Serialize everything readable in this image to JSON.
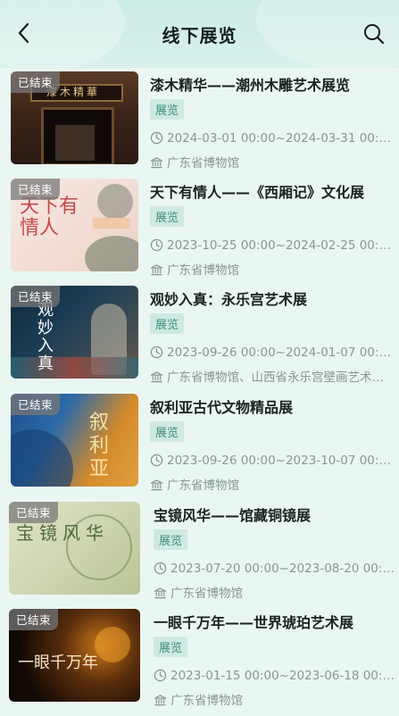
{
  "header": {
    "title": "线下展览",
    "back_icon": "chevron-left-icon",
    "search_icon": "search-icon"
  },
  "colors": {
    "background": "#eaf6f2",
    "tag_bg": "#cfe9e2",
    "tag_text": "#3f8d7f",
    "meta_text": "#8a9694",
    "badge_bg": "#8a8a8a"
  },
  "exhibitions": [
    {
      "badge": "已结束",
      "title": "漆木精华——潮州木雕艺术展览",
      "tag": "展览",
      "date": "2024-03-01 00:00~2024-03-31 00:00",
      "venue": "广东省博物馆",
      "poster_text": "漆木精華"
    },
    {
      "badge": "已结束",
      "title": "天下有情人——《西厢记》文化展",
      "tag": "展览",
      "date": "2023-10-25 00:00~2024-02-25 00:00",
      "venue": "广东省博物馆",
      "poster_text": "天下有情人"
    },
    {
      "badge": "已结束",
      "title": "观妙入真：永乐宫艺术展",
      "tag": "展览",
      "date": "2023-09-26 00:00~2024-01-07 00:00",
      "venue": "广东省博物馆、山西省永乐宫壁画艺术博物馆",
      "poster_text": "观妙入真"
    },
    {
      "badge": "已结束",
      "title": "叙利亚古代文物精品展",
      "tag": "展览",
      "date": "2023-09-26 00:00~2023-10-07 00:00",
      "venue": "广东省博物馆",
      "poster_text": "叙利亚"
    },
    {
      "badge": "已结束",
      "title": "宝镜风华——馆藏铜镜展",
      "tag": "展览",
      "date": "2023-07-20 00:00~2023-08-20 00:00",
      "venue": "广东省博物馆",
      "poster_text": "宝镜风华"
    },
    {
      "badge": "已结束",
      "title": "一眼千万年——世界琥珀艺术展",
      "tag": "展览",
      "date": "2023-01-15 00:00~2023-06-18 00:00",
      "venue": "广东省博物馆",
      "poster_text": "一眼千万年"
    }
  ]
}
